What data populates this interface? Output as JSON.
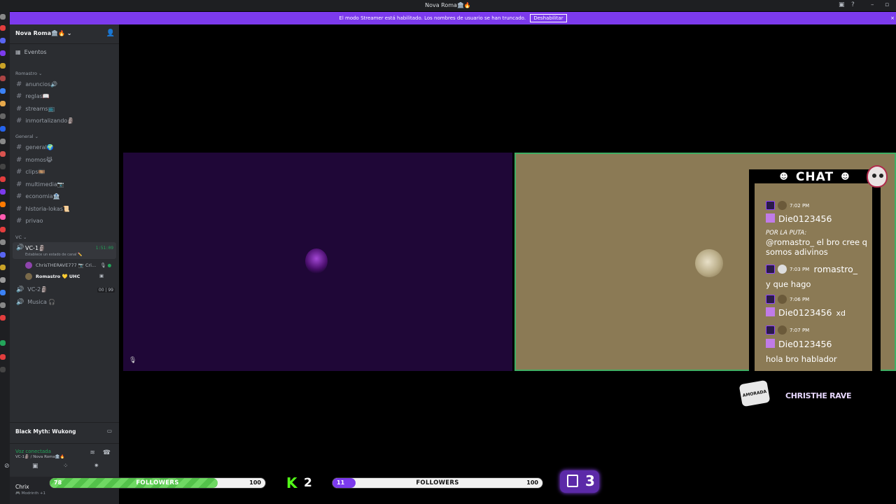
{
  "window": {
    "title": "Nova Roma🏛️🔥"
  },
  "banner": {
    "message": "El modo Streamer está habilitado. Los nombres de usuario se han truncado.",
    "button_label": "Deshabilitar"
  },
  "sidebar": {
    "server_name": "Nova Roma🏛️🔥",
    "events_label": "Eventos",
    "categories": [
      {
        "name": "Romastro ⌄",
        "channels": [
          {
            "label": "anuncios🔊"
          },
          {
            "label": "reglas📖"
          },
          {
            "label": "streams📺"
          },
          {
            "label": "inmortalizando🗿"
          }
        ]
      },
      {
        "name": "General ⌄",
        "channels": [
          {
            "label": "general🌍"
          },
          {
            "label": "momos😹"
          },
          {
            "label": "clips🎞️"
          },
          {
            "label": "multimedia📷"
          },
          {
            "label": "economia🏦"
          },
          {
            "label": "historia-lokas📜"
          },
          {
            "label": "privao"
          }
        ]
      },
      {
        "name": "VC ⌄"
      }
    ],
    "voice_channels": {
      "active": {
        "name": "VC-1🗿",
        "duration": "1:51:09",
        "status": "Establece un estado de canal ✏️"
      },
      "members": [
        {
          "name": "ChrisTHERAVE777 📷 Cri...",
          "color": "#8e44ad"
        },
        {
          "name": "Romastro 💛 UHC",
          "color": "#7a6a4a"
        }
      ],
      "others": [
        {
          "name": "VC-2🗿",
          "count_a": "00",
          "count_b": "99"
        },
        {
          "name": "Musica 🎧"
        }
      ]
    },
    "activity": "Black Myth: Wukong",
    "voice_status": {
      "label": "Voz conectada",
      "location": "VC-1🗿 / Nova Roma🏛️🔥"
    },
    "user": {
      "name": "Chrix",
      "status": "🎮 Modrinth +1"
    }
  },
  "chat_overlay": {
    "header": "CHAT",
    "messages": [
      {
        "time": "7:02 PM",
        "user": "Die0123456",
        "text_caps": "POR LA PUTA:",
        "text": "@romastro_ el bro cree q somos adivinos"
      },
      {
        "time": "7:03 PM",
        "user": "romastro_",
        "text": "y que hago"
      },
      {
        "time": "7:06 PM",
        "user": "Die0123456",
        "text": "xd"
      },
      {
        "time": "7:07 PM",
        "user": "Die0123456",
        "text": "hola bro hablador"
      }
    ],
    "streamer_tag": "CHRISTHE RAVE",
    "logo_text": "AMORADA"
  },
  "goals": {
    "kick": {
      "current": "78",
      "label": "FOLLOWERS",
      "goal": "100",
      "fraction": 0.78,
      "fill_color": "#53c24a"
    },
    "kick_count": "2",
    "twitch": {
      "current": "11",
      "label": "FOLLOWERS",
      "goal": "100",
      "fraction": 0.11,
      "fill_color": "#7c3aed"
    },
    "twitch_count": "3"
  },
  "colors": {
    "accent": "#7c3aed",
    "connected": "#23a55a",
    "kick": "#53fc18",
    "twitch": "#9146ff"
  }
}
